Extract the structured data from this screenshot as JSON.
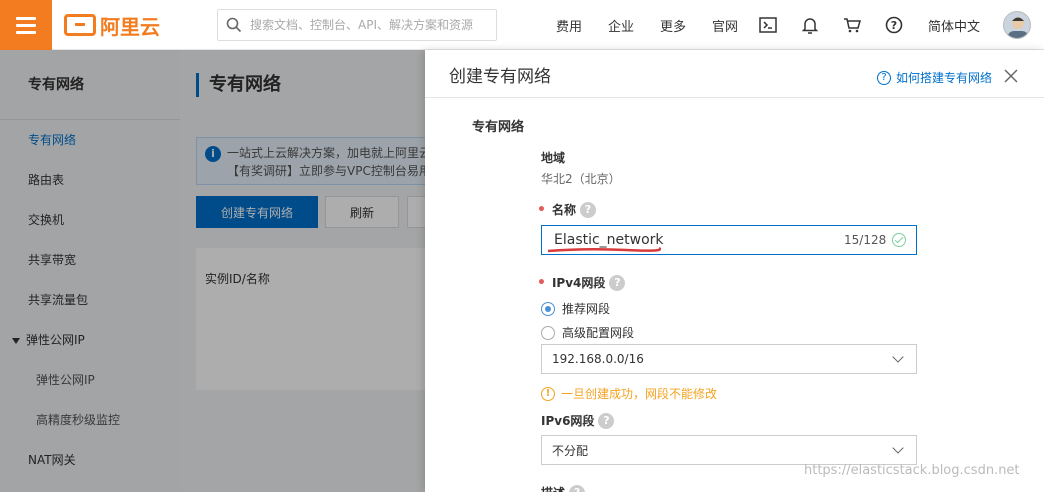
{
  "header": {
    "logo_text": "阿里云",
    "search_placeholder": "搜索文档、控制台、API、解决方案和资源",
    "nav_links": [
      "费用",
      "企业",
      "更多",
      "官网"
    ],
    "language": "简体中文"
  },
  "sidebar": {
    "title": "专有网络",
    "items": [
      {
        "label": "专有网络"
      },
      {
        "label": "路由表"
      },
      {
        "label": "交换机"
      },
      {
        "label": "共享带宽"
      },
      {
        "label": "共享流量包"
      },
      {
        "label": "弹性公网IP"
      },
      {
        "label": "弹性公网IP"
      },
      {
        "label": "高精度秒级监控"
      },
      {
        "label": "NAT网关"
      }
    ]
  },
  "main": {
    "title": "专有网络",
    "notice_line1": "一站式上云解决方案，加电就上阿里云",
    "notice_line2": "【有奖调研】立即参与VPC控制台易用",
    "create_button": "创建专有网络",
    "refresh_button": "刷新",
    "table_header": "实例ID/名称"
  },
  "drawer": {
    "title": "创建专有网络",
    "help_link": "如何搭建专有网络",
    "section_title": "专有网络",
    "region_label": "地域",
    "region_value": "华北2（北京）",
    "name_label": "名称",
    "name_value": "Elastic_network",
    "name_counter": "15/128",
    "ipv4_label": "IPv4网段",
    "ipv4_options": [
      "推荐网段",
      "高级配置网段"
    ],
    "ipv4_selected": "推荐网段",
    "ipv4_cidr": "192.168.0.0/16",
    "ipv4_warning": "一旦创建成功，网段不能修改",
    "ipv6_label": "IPv6网段",
    "ipv6_value": "不分配",
    "description_label": "描述"
  },
  "watermark": "https://elasticstack.blog.csdn.net",
  "colors": {
    "brand": "#f47c20",
    "primary": "#0070cc",
    "warning": "#f4a321",
    "required": "#e35b5b"
  }
}
